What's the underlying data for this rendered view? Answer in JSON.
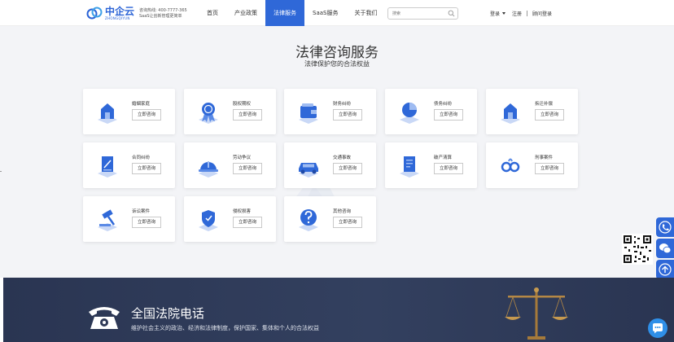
{
  "header": {
    "logo_cn": "中企云",
    "logo_en": "ZHONGQIYUN",
    "hotline_line1": "咨询热线: 400-7777-365",
    "hotline_line2": "SaaS让创新管理更简单",
    "nav": [
      {
        "label": "首页",
        "active": false
      },
      {
        "label": "产业政策",
        "active": false
      },
      {
        "label": "法律服务",
        "active": true
      },
      {
        "label": "SaaS服务",
        "active": false
      },
      {
        "label": "关于我们",
        "active": false
      }
    ],
    "search_placeholder": "搜索",
    "login": "登录",
    "register": "注册",
    "consultant": "顾问登录"
  },
  "main": {
    "title": "法律咨询服务",
    "subtitle": "法律保护您的合法权益",
    "button_label": "立即咨询",
    "cards": [
      {
        "label": "婚姻家庭",
        "icon": "house-icon"
      },
      {
        "label": "股权期权",
        "icon": "medal-icon"
      },
      {
        "label": "财务纠纷",
        "icon": "wallet-icon"
      },
      {
        "label": "债务纠纷",
        "icon": "pie-chart-icon"
      },
      {
        "label": "拆迁补偿",
        "icon": "house-icon"
      },
      {
        "label": "合同纠纷",
        "icon": "contract-icon"
      },
      {
        "label": "劳动争议",
        "icon": "helmet-icon"
      },
      {
        "label": "交通事故",
        "icon": "car-icon"
      },
      {
        "label": "破产清算",
        "icon": "document-icon"
      },
      {
        "label": "刑事案件",
        "icon": "handcuffs-icon"
      },
      {
        "label": "诉讼案件",
        "icon": "gavel-icon"
      },
      {
        "label": "侵权损害",
        "icon": "shield-icon"
      },
      {
        "label": "其他咨询",
        "icon": "question-icon"
      }
    ]
  },
  "footer": {
    "title": "全国法院电话",
    "subtitle": "维护社会主义的政治、经济和法律制度，保护国家、集体和个人的合法权益"
  },
  "colors": {
    "accent": "#2f68d8",
    "footer_bg": "#2f3a57",
    "page_bg": "#f3f4f7"
  }
}
